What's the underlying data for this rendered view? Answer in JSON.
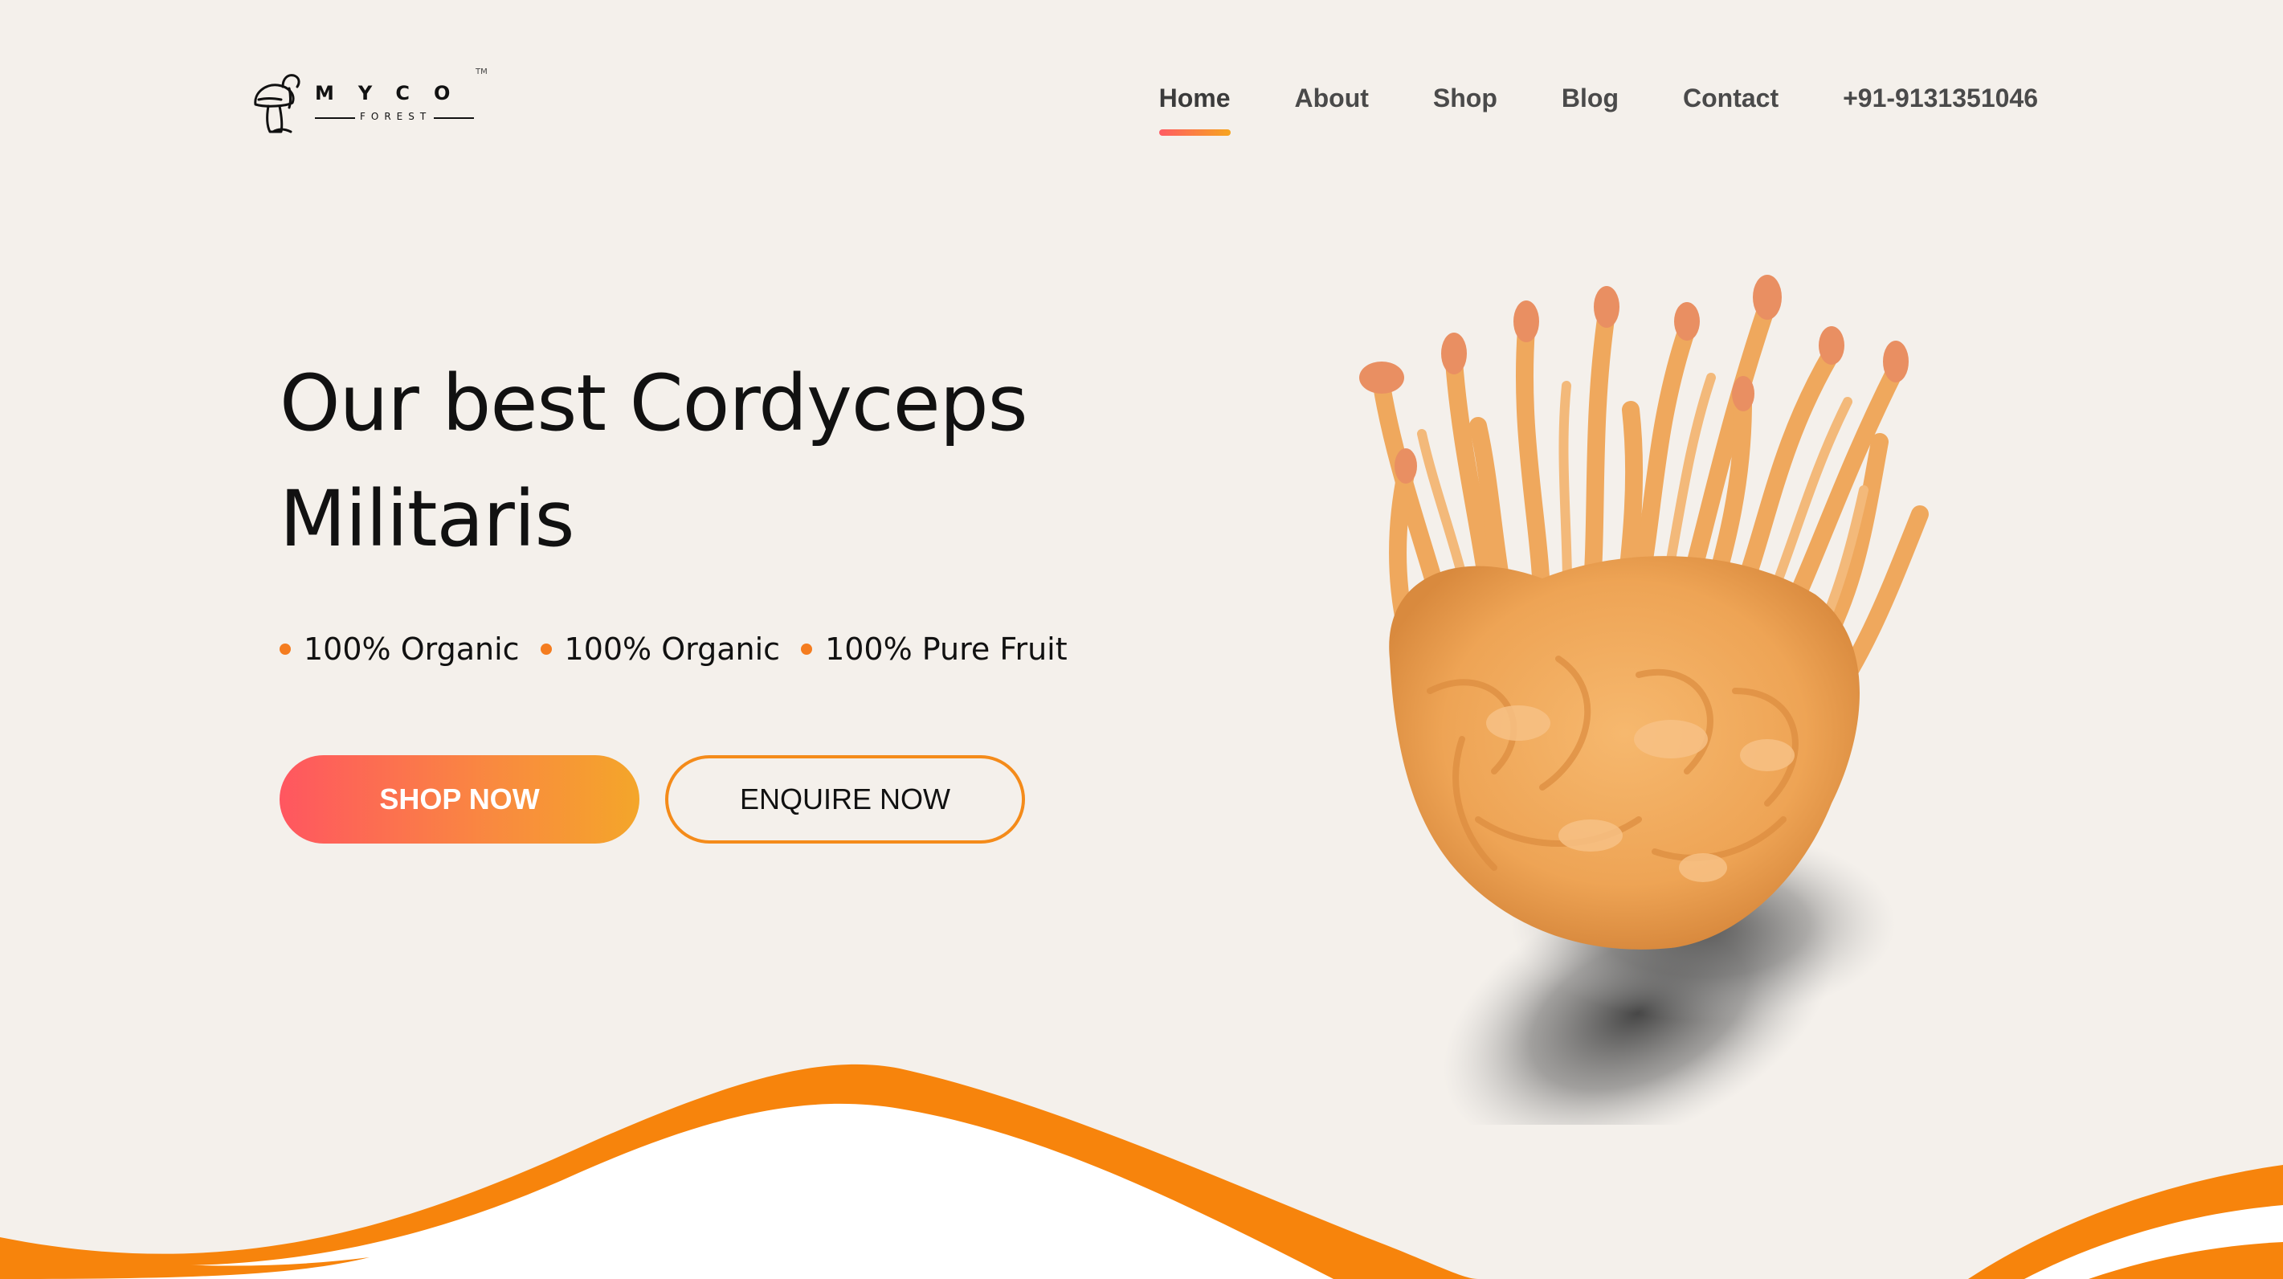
{
  "brand": {
    "wordmark": "MYCO",
    "subtitle": "FOREST",
    "trademark": "TM"
  },
  "nav": {
    "items": [
      {
        "label": "Home",
        "active": true
      },
      {
        "label": "About",
        "active": false
      },
      {
        "label": "Shop",
        "active": false
      },
      {
        "label": "Blog",
        "active": false
      },
      {
        "label": "Contact",
        "active": false
      },
      {
        "label": "+91-9131351046",
        "active": false
      }
    ]
  },
  "hero": {
    "title": "Our best Cordyceps Militaris",
    "features": [
      "100% Organic",
      "100% Organic",
      "100% Pure Fruit"
    ],
    "primary_button": "SHOP NOW",
    "secondary_button": "ENQUIRE NOW"
  },
  "colors": {
    "background": "#f4f0eb",
    "accent_orange": "#f7840c",
    "gradient_start": "#ff5660",
    "gradient_end": "#f4a62a",
    "nav_text": "#4a4a4a"
  },
  "icons": {
    "logo": "mushroom-logo-icon",
    "bullet": "orange-dot-icon"
  }
}
